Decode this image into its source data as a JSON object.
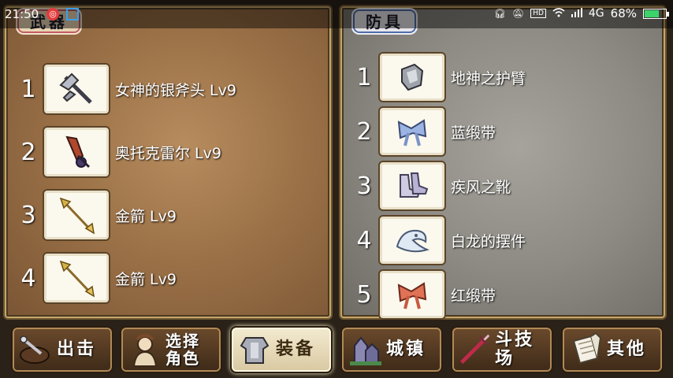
{
  "status_bar": {
    "time": "21:50",
    "network": "4G",
    "battery": "68%",
    "battery_level": 0.68
  },
  "weapons": {
    "title": "武器",
    "items": [
      {
        "num": "1",
        "name": "女神的银斧头 Lv9",
        "icon": "silver-axe-icon"
      },
      {
        "num": "2",
        "name": "奥托克雷尔 Lv9",
        "icon": "dark-sword-icon"
      },
      {
        "num": "3",
        "name": "金箭 Lv9",
        "icon": "golden-arrow-icon"
      },
      {
        "num": "4",
        "name": "金箭 Lv9",
        "icon": "golden-arrow-icon"
      }
    ]
  },
  "armor": {
    "title": "防具",
    "items": [
      {
        "num": "1",
        "name": "地神之护臂",
        "icon": "bracer-icon"
      },
      {
        "num": "2",
        "name": "蓝缎带",
        "icon": "blue-ribbon-icon"
      },
      {
        "num": "3",
        "name": "疾风之靴",
        "icon": "boots-icon"
      },
      {
        "num": "4",
        "name": "白龙的摆件",
        "icon": "white-dragon-icon"
      },
      {
        "num": "5",
        "name": "红缎带",
        "icon": "red-ribbon-icon"
      }
    ]
  },
  "nav": [
    {
      "label": "出击",
      "icon": "attack-icon"
    },
    {
      "label_line1": "选择",
      "label_line2": "角色",
      "icon": "character-icon"
    },
    {
      "label": "装备",
      "icon": "equipment-icon",
      "active": true
    },
    {
      "label": "城镇",
      "icon": "town-icon"
    },
    {
      "label": "斗技场",
      "icon": "arena-icon"
    },
    {
      "label": "其他",
      "icon": "other-icon"
    }
  ],
  "colors": {
    "weapons_panel": "#9c7248",
    "armor_panel": "#8e8b84",
    "active_nav": "#f3ead0",
    "battery_fill": "#3bd36a"
  }
}
